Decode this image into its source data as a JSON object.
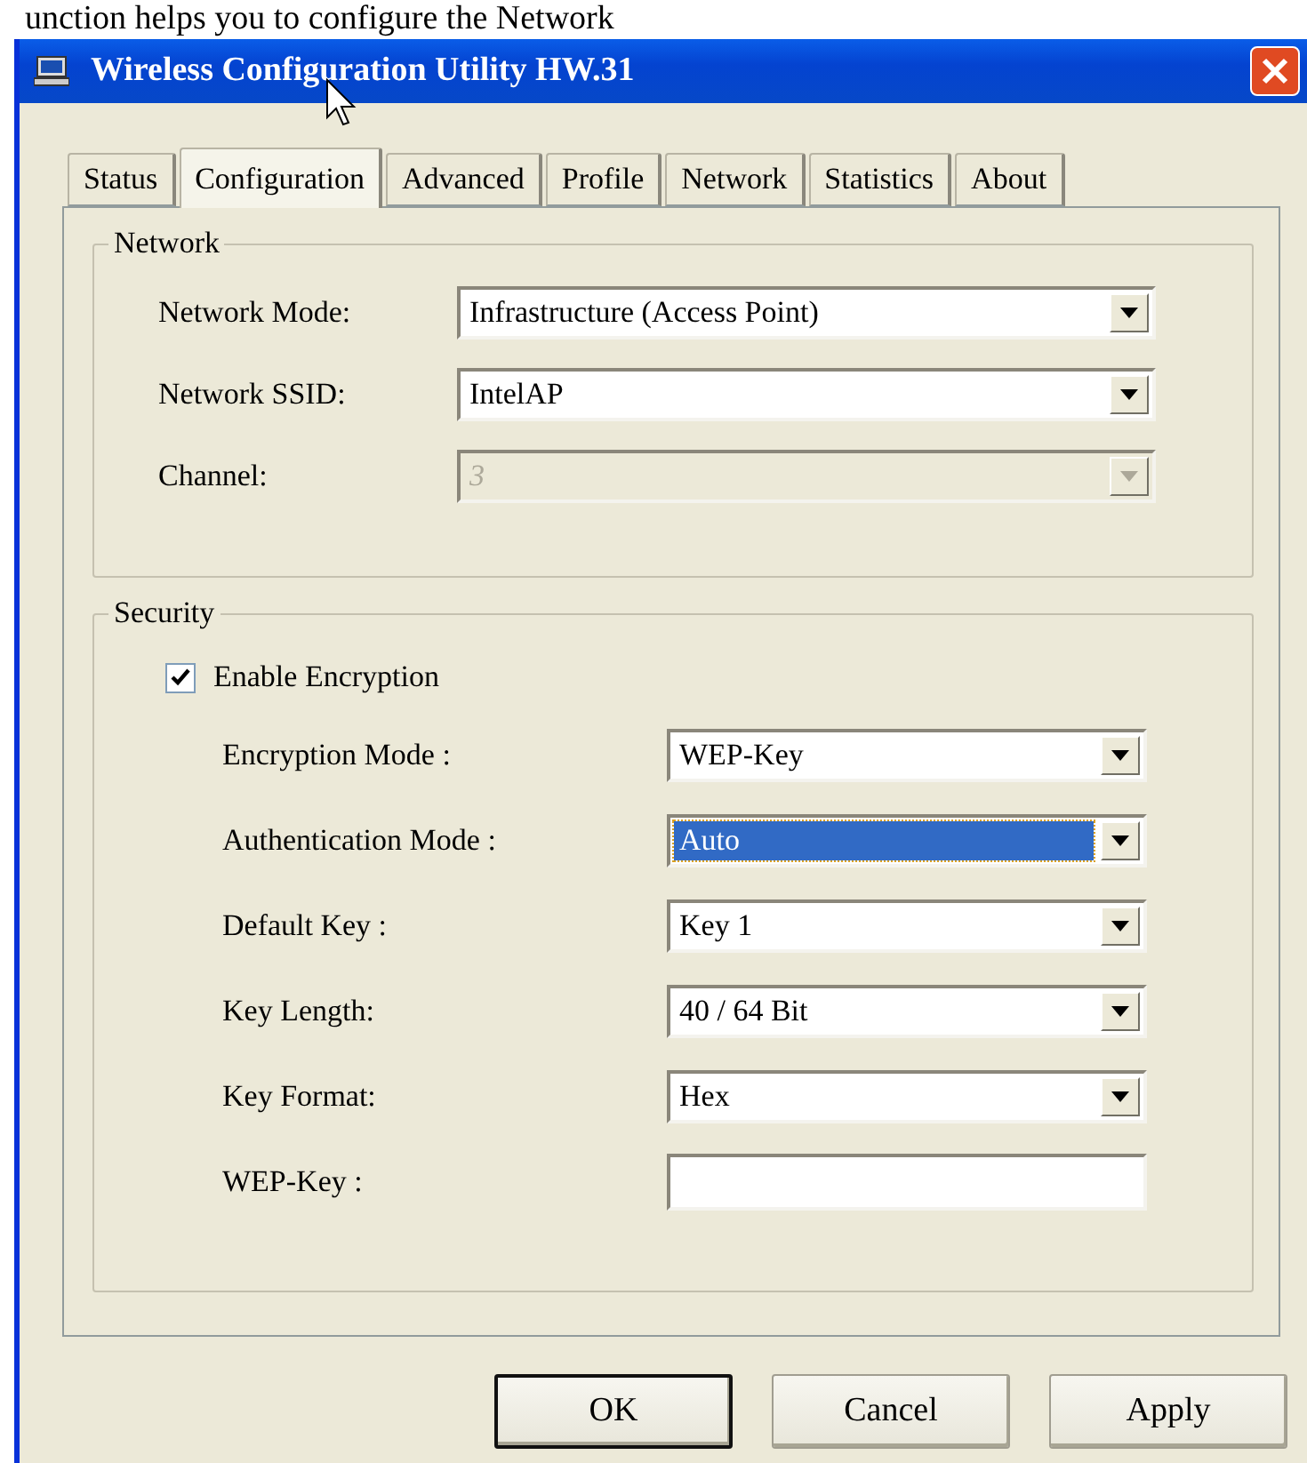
{
  "caption": "unction helps you to configure the Network",
  "window": {
    "title": "Wireless Configuration Utility HW.31"
  },
  "tabs": [
    {
      "label": "Status",
      "selected": false
    },
    {
      "label": "Configuration",
      "selected": true
    },
    {
      "label": "Advanced",
      "selected": false
    },
    {
      "label": "Profile",
      "selected": false
    },
    {
      "label": "Network",
      "selected": false
    },
    {
      "label": "Statistics",
      "selected": false
    },
    {
      "label": "About",
      "selected": false
    }
  ],
  "network": {
    "title": "Network",
    "fields": [
      {
        "label": "Network Mode:",
        "value": "Infrastructure (Access Point)",
        "disabled": false
      },
      {
        "label": "Network SSID:",
        "value": "IntelAP",
        "disabled": false
      },
      {
        "label": "Channel:",
        "value": "3",
        "disabled": true
      }
    ]
  },
  "security": {
    "title": "Security",
    "enable_encryption": {
      "label": "Enable Encryption",
      "checked": true
    },
    "fields": [
      {
        "kind": "dropdown",
        "label": "Encryption Mode :",
        "value": "WEP-Key",
        "focused": false
      },
      {
        "kind": "dropdown",
        "label": "Authentication Mode :",
        "value": "Auto",
        "focused": true
      },
      {
        "kind": "dropdown",
        "label": "Default Key :",
        "value": "Key 1",
        "focused": false
      },
      {
        "kind": "dropdown",
        "label": "Key Length:",
        "value": "40 / 64 Bit",
        "focused": false
      },
      {
        "kind": "dropdown",
        "label": "Key Format:",
        "value": "Hex",
        "focused": false
      },
      {
        "kind": "text",
        "label": "WEP-Key :"
      }
    ]
  },
  "buttons": [
    {
      "label": "OK",
      "default": true
    },
    {
      "label": "Cancel",
      "default": false
    },
    {
      "label": "Apply",
      "default": false
    }
  ]
}
